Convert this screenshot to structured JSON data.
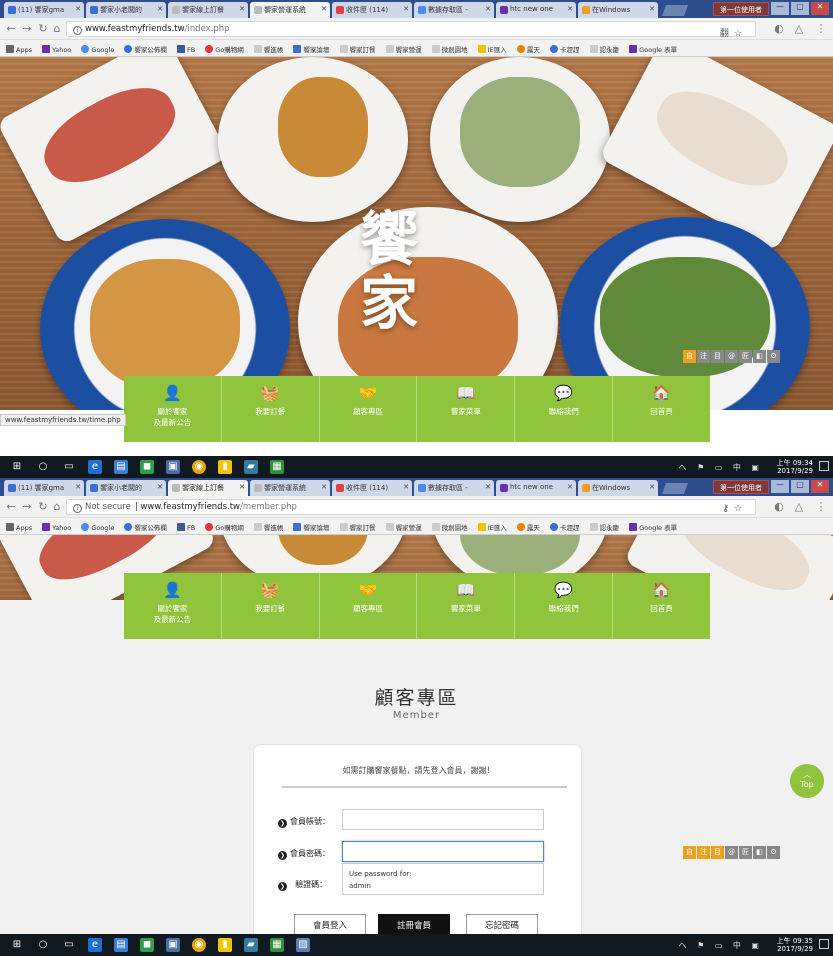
{
  "browser": {
    "tabs": [
      "(11) 饗家gma",
      "饗家小老闆的",
      "饗家線上訂餐",
      "饗家營運系統",
      "收件匣 (114)",
      "數據存取區 -",
      "htc new one",
      "在Windows"
    ],
    "user_badge": "第一位使用者",
    "window_buttons": [
      "—",
      "▢",
      "✕"
    ],
    "url1": "www.feastmyfriends.tw",
    "path1": "/index.php",
    "not_secure": "Not secure",
    "url2": "www.feastmyfriends.tw",
    "path2": "/member.php",
    "bookmarks": [
      "Apps",
      "Yahoo",
      "Google",
      "饗家公佈欄",
      "FB",
      "Go購物網",
      "饗進帳",
      "饗家論壇",
      "饗家訂餐",
      "饗家營運",
      "微創園地",
      "IE匯入",
      "露天",
      "卡趕趕",
      "認永慶",
      "Google 表單"
    ]
  },
  "hero": {
    "logo_line1": "饗",
    "logo_line2": "家"
  },
  "tinybar": [
    "自",
    "注",
    "目",
    "@",
    "匠",
    "◧",
    "⚙"
  ],
  "tinybar_colors": [
    "#f0a020",
    "#888888",
    "#888888",
    "#888888",
    "#888888",
    "#888888",
    "#888888"
  ],
  "nav": {
    "items": [
      {
        "icon": "person-icon",
        "glyph": "👤",
        "label": "關於饗家",
        "label2": "及最新公告"
      },
      {
        "icon": "basket-icon",
        "glyph": "🧺",
        "label": "我要訂餐",
        "label2": ""
      },
      {
        "icon": "handshake-icon",
        "glyph": "🤝",
        "label": "顧客專區",
        "label2": ""
      },
      {
        "icon": "book-icon",
        "glyph": "📖",
        "label": "饗家菜單",
        "label2": ""
      },
      {
        "icon": "chat-icon",
        "glyph": "💬",
        "label": "聯絡我們",
        "label2": ""
      },
      {
        "icon": "home-icon",
        "glyph": "🏠",
        "label": "回首頁",
        "label2": ""
      }
    ],
    "color": "#8fc43c"
  },
  "status_url": "www.feastmyfriends.tw/time.php",
  "taskbar": {
    "time1": "上午 09:34",
    "date1": "2017/9/29",
    "time2": "上午 09:35",
    "date2": "2017/9/29",
    "tray": "へ ⚑ ▭ 中 ▣"
  },
  "member": {
    "title": "顧客專區",
    "subtitle": "Member",
    "notice": "如需訂購饗家餐點，請先登入會員，謝謝！",
    "account_label": "會員帳號：",
    "password_label": "會員密碼：",
    "captcha_label": "驗證碼：",
    "autofill_title": "Use password for:",
    "autofill_user": "admin",
    "login_button": "會員登入",
    "register_button": "註冊會員",
    "forgot_button": "忘記密碼",
    "top_button": "Top"
  }
}
